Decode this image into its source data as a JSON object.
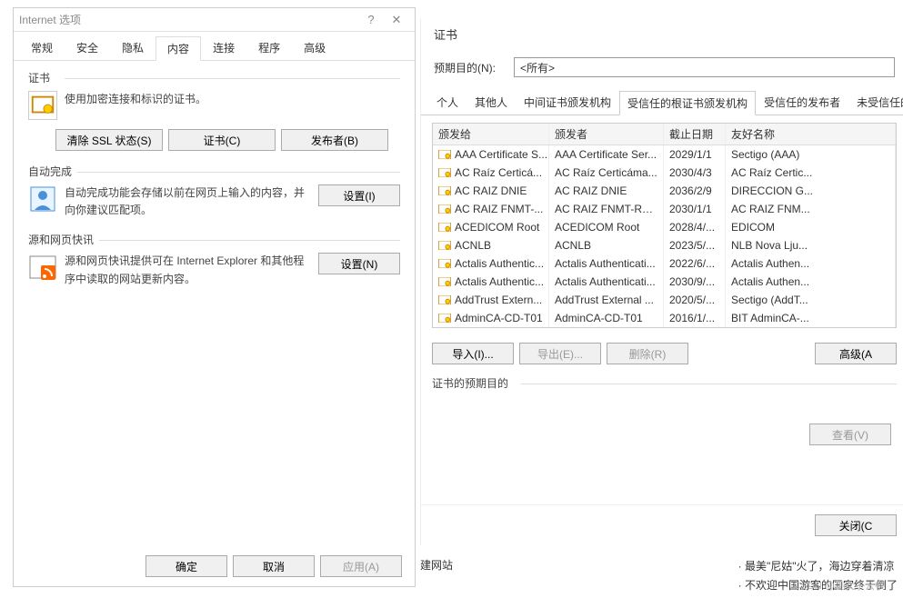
{
  "left": {
    "title": "Internet 选项",
    "tabs": [
      "常规",
      "安全",
      "隐私",
      "内容",
      "连接",
      "程序",
      "高级"
    ],
    "active_tab": "内容",
    "cert_section": {
      "title": "证书",
      "desc": "使用加密连接和标识的证书。",
      "buttons": {
        "clear_ssl": "清除 SSL 状态(S)",
        "cert": "证书(C)",
        "publisher": "发布者(B)"
      }
    },
    "autocomplete": {
      "title": "自动完成",
      "desc": "自动完成功能会存储以前在网页上输入的内容，并向你建议匹配项。",
      "settings_btn": "设置(I)"
    },
    "feeds": {
      "title": "源和网页快讯",
      "desc": "源和网页快讯提供可在 Internet Explorer 和其他程序中读取的网站更新内容。",
      "settings_btn": "设置(N)"
    },
    "bottom": {
      "ok": "确定",
      "cancel": "取消",
      "apply": "应用(A)"
    }
  },
  "right": {
    "title": "证书",
    "purpose_label": "预期目的(N):",
    "purpose_value": "<所有>",
    "tabs": [
      "个人",
      "其他人",
      "中间证书颁发机构",
      "受信任的根证书颁发机构",
      "受信任的发布者",
      "未受信任的发布"
    ],
    "active_tab": "受信任的根证书颁发机构",
    "columns": {
      "c1": "颁发给",
      "c2": "颁发者",
      "c3": "截止日期",
      "c4": "友好名称"
    },
    "rows": [
      {
        "c1": "AAA Certificate S...",
        "c2": "AAA Certificate Ser...",
        "c3": "2029/1/1",
        "c4": "Sectigo (AAA)"
      },
      {
        "c1": "AC Raíz Certicá...",
        "c2": "AC Raíz Certicáma...",
        "c3": "2030/4/3",
        "c4": "AC Raíz Certic..."
      },
      {
        "c1": "AC RAIZ DNIE",
        "c2": "AC RAIZ DNIE",
        "c3": "2036/2/9",
        "c4": "DIRECCION G..."
      },
      {
        "c1": "AC RAIZ FNMT-...",
        "c2": "AC RAIZ FNMT-RC...",
        "c3": "2030/1/1",
        "c4": "AC RAIZ FNM..."
      },
      {
        "c1": "ACEDICOM Root",
        "c2": "ACEDICOM Root",
        "c3": "2028/4/...",
        "c4": "EDICOM"
      },
      {
        "c1": "ACNLB",
        "c2": "ACNLB",
        "c3": "2023/5/...",
        "c4": "NLB Nova Lju..."
      },
      {
        "c1": "Actalis Authentic...",
        "c2": "Actalis Authenticati...",
        "c3": "2022/6/...",
        "c4": "Actalis Authen..."
      },
      {
        "c1": "Actalis Authentic...",
        "c2": "Actalis Authenticati...",
        "c3": "2030/9/...",
        "c4": "Actalis Authen..."
      },
      {
        "c1": "AddTrust Extern...",
        "c2": "AddTrust External ...",
        "c3": "2020/5/...",
        "c4": "Sectigo (AddT..."
      },
      {
        "c1": "AdminCA-CD-T01",
        "c2": "AdminCA-CD-T01",
        "c3": "2016/1/...",
        "c4": "BIT AdminCA-..."
      }
    ],
    "actions": {
      "import": "导入(I)...",
      "export": "导出(E)...",
      "delete": "删除(R)",
      "advanced": "高级(A"
    },
    "purpose_group": "证书的预期目的",
    "view_btn": "查看(V)",
    "close_btn": "关闭(C"
  },
  "misc": {
    "build_link": "建网站",
    "news1": "· 最美\"尼姑\"火了，海边穿着清凉",
    "news2": "· 不欢迎中国游客的国家终于倒了",
    "watermark": "CSDN @美女子云亭"
  }
}
